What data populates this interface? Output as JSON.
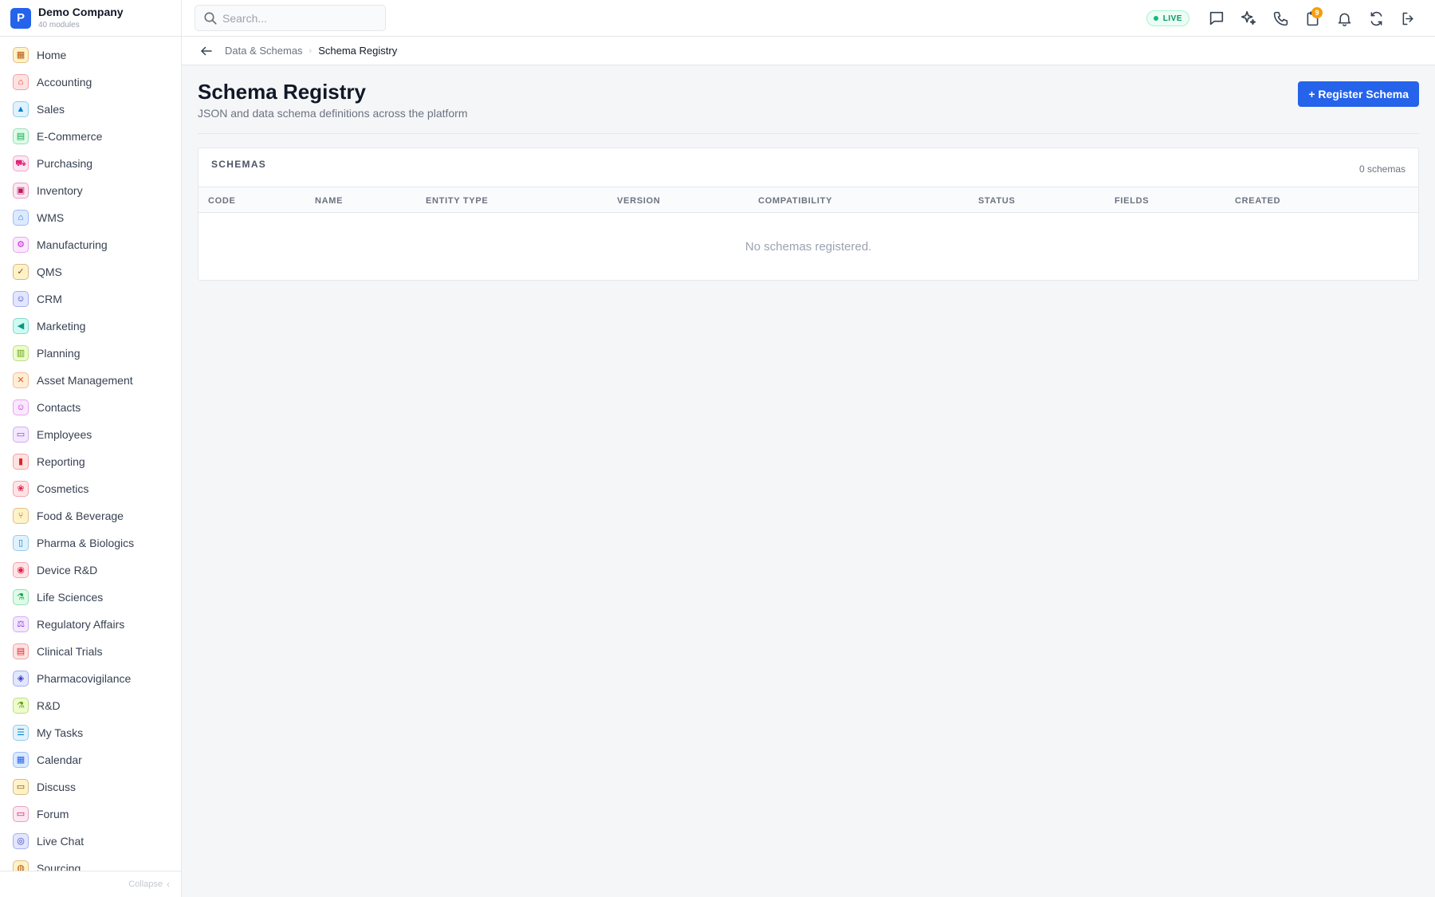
{
  "brand": {
    "logo_letter": "P",
    "name": "Demo Company",
    "subtitle": "40 modules"
  },
  "sidebar": {
    "items": [
      {
        "label": "Home",
        "icon": "grid-icon",
        "glyph": "▦",
        "color": "#b45309",
        "bg": "#fef3c7"
      },
      {
        "label": "Accounting",
        "icon": "bank-icon",
        "glyph": "⌂",
        "color": "#dc2626",
        "bg": "#fee2e2"
      },
      {
        "label": "Sales",
        "icon": "tag-icon",
        "glyph": "▲",
        "color": "#0284c7",
        "bg": "#e0f2fe"
      },
      {
        "label": "E-Commerce",
        "icon": "store-icon",
        "glyph": "▤",
        "color": "#16a34a",
        "bg": "#dcfce7"
      },
      {
        "label": "Purchasing",
        "icon": "cart-icon",
        "glyph": "⛟",
        "color": "#db2777",
        "bg": "#fce7f3"
      },
      {
        "label": "Inventory",
        "icon": "box-icon",
        "glyph": "▣",
        "color": "#be185d",
        "bg": "#fce7f3"
      },
      {
        "label": "WMS",
        "icon": "warehouse-icon",
        "glyph": "⌂",
        "color": "#2563eb",
        "bg": "#dbeafe"
      },
      {
        "label": "Manufacturing",
        "icon": "factory-icon",
        "glyph": "⚙",
        "color": "#c026d3",
        "bg": "#fae8ff"
      },
      {
        "label": "QMS",
        "icon": "badge-check-icon",
        "glyph": "✓",
        "color": "#92400e",
        "bg": "#fef3c7"
      },
      {
        "label": "CRM",
        "icon": "users-icon",
        "glyph": "☺",
        "color": "#4338ca",
        "bg": "#e0e7ff"
      },
      {
        "label": "Marketing",
        "icon": "megaphone-icon",
        "glyph": "◀",
        "color": "#0d9488",
        "bg": "#ccfbf1"
      },
      {
        "label": "Planning",
        "icon": "clipboard-icon",
        "glyph": "▥",
        "color": "#65a30d",
        "bg": "#ecfccb"
      },
      {
        "label": "Asset Management",
        "icon": "tools-icon",
        "glyph": "✕",
        "color": "#ea580c",
        "bg": "#ffedd5"
      },
      {
        "label": "Contacts",
        "icon": "contact-card-icon",
        "glyph": "☺",
        "color": "#c026d3",
        "bg": "#fae8ff"
      },
      {
        "label": "Employees",
        "icon": "briefcase-icon",
        "glyph": "▭",
        "color": "#9333ea",
        "bg": "#f3e8ff"
      },
      {
        "label": "Reporting",
        "icon": "bar-chart-icon",
        "glyph": "▮",
        "color": "#dc2626",
        "bg": "#fee2e2"
      },
      {
        "label": "Cosmetics",
        "icon": "lotus-icon",
        "glyph": "❀",
        "color": "#e11d48",
        "bg": "#ffe4e6"
      },
      {
        "label": "Food & Beverage",
        "icon": "utensils-icon",
        "glyph": "⑂",
        "color": "#b45309",
        "bg": "#fef3c7"
      },
      {
        "label": "Pharma & Biologics",
        "icon": "pill-bottle-icon",
        "glyph": "▯",
        "color": "#0284c7",
        "bg": "#e0f2fe"
      },
      {
        "label": "Device R&D",
        "icon": "chip-icon",
        "glyph": "◉",
        "color": "#e11d48",
        "bg": "#ffe4e6"
      },
      {
        "label": "Life Sciences",
        "icon": "microscope-icon",
        "glyph": "⚗",
        "color": "#16a34a",
        "bg": "#dcfce7"
      },
      {
        "label": "Regulatory Affairs",
        "icon": "gavel-icon",
        "glyph": "⚖",
        "color": "#9333ea",
        "bg": "#f3e8ff"
      },
      {
        "label": "Clinical Trials",
        "icon": "clipboard-medical-icon",
        "glyph": "▤",
        "color": "#dc2626",
        "bg": "#fee2e2"
      },
      {
        "label": "Pharmacovigilance",
        "icon": "shield-icon",
        "glyph": "◈",
        "color": "#4338ca",
        "bg": "#e0e7ff"
      },
      {
        "label": "R&D",
        "icon": "flask-icon",
        "glyph": "⚗",
        "color": "#65a30d",
        "bg": "#ecfccb"
      },
      {
        "label": "My Tasks",
        "icon": "checklist-icon",
        "glyph": "☰",
        "color": "#0284c7",
        "bg": "#e0f2fe"
      },
      {
        "label": "Calendar",
        "icon": "calendar-icon",
        "glyph": "▦",
        "color": "#2563eb",
        "bg": "#dbeafe"
      },
      {
        "label": "Discuss",
        "icon": "chat-bubbles-icon",
        "glyph": "▭",
        "color": "#92400e",
        "bg": "#fef3c7"
      },
      {
        "label": "Forum",
        "icon": "forum-icon",
        "glyph": "▭",
        "color": "#be185d",
        "bg": "#fce7f3"
      },
      {
        "label": "Live Chat",
        "icon": "headset-icon",
        "glyph": "◎",
        "color": "#4338ca",
        "bg": "#e0e7ff"
      },
      {
        "label": "Sourcing",
        "icon": "sourcing-icon",
        "glyph": "◍",
        "color": "#b45309",
        "bg": "#fef3c7"
      }
    ],
    "collapse_label": "Collapse"
  },
  "topbar": {
    "search_placeholder": "Search...",
    "live_label": "LIVE",
    "notification_count": "9",
    "icons": [
      "chat-icon",
      "sparkles-icon",
      "phone-icon",
      "clipboard-icon",
      "bell-icon",
      "sync-icon",
      "logout-icon"
    ]
  },
  "breadcrumb": {
    "parent": "Data & Schemas",
    "current": "Schema Registry"
  },
  "page": {
    "title": "Schema Registry",
    "subtitle": "JSON and data schema definitions across the platform",
    "register_button": "+ Register Schema"
  },
  "table": {
    "title": "SCHEMAS",
    "count": "0 schemas",
    "columns": [
      "CODE",
      "NAME",
      "ENTITY TYPE",
      "VERSION",
      "COMPATIBILITY",
      "STATUS",
      "FIELDS",
      "CREATED"
    ],
    "empty_message": "No schemas registered."
  },
  "colors": {
    "accent": "#2563eb",
    "live": "#059669",
    "badge": "#f59e0b"
  }
}
